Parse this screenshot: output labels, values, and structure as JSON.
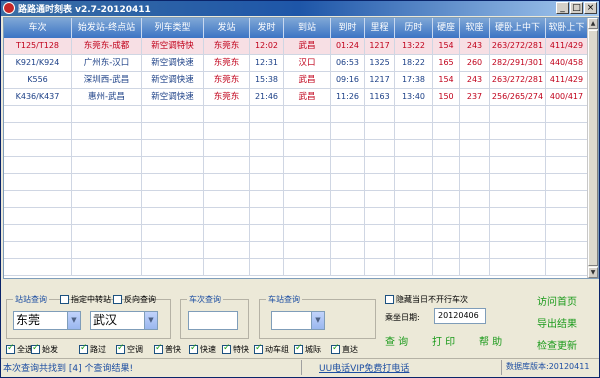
{
  "window": {
    "title": "路路通时刻表 v2.7-20120411",
    "minimize": "_",
    "maximize": "□",
    "close": "×"
  },
  "grid": {
    "columns": [
      "车次",
      "始发站-终点站",
      "列车类型",
      "发站",
      "发时",
      "到站",
      "到时",
      "里程",
      "历时",
      "硬座",
      "软座",
      "硬卧上中下",
      "软卧上下"
    ],
    "rows": [
      [
        "T125/T128",
        "东莞东-成都",
        "新空调特快",
        "东莞东",
        "12:02",
        "武昌",
        "01:24",
        "1217",
        "13:22",
        "154",
        "243",
        "263/272/281",
        "411/429"
      ],
      [
        "K921/K924",
        "广州东-汉口",
        "新空调快速",
        "东莞东",
        "12:31",
        "汉口",
        "06:53",
        "1325",
        "18:22",
        "165",
        "260",
        "282/291/301",
        "440/458"
      ],
      [
        "K556",
        "深圳西-武昌",
        "新空调快速",
        "东莞东",
        "15:38",
        "武昌",
        "09:16",
        "1217",
        "17:38",
        "154",
        "243",
        "263/272/281",
        "411/429"
      ],
      [
        "K436/K437",
        "惠州-武昌",
        "新空调快速",
        "东莞东",
        "21:46",
        "武昌",
        "11:26",
        "1163",
        "13:40",
        "150",
        "237",
        "256/265/274",
        "400/417"
      ]
    ],
    "selected_row": 0
  },
  "station_query": {
    "label": "站站查询",
    "transfer_label": "指定中转站",
    "reverse_label": "反向查询",
    "from_value": "东莞",
    "to_value": "武汉"
  },
  "train_query": {
    "label": "车次查询",
    "value": ""
  },
  "stop_query": {
    "label": "车站查询",
    "value": ""
  },
  "hide_label": "隐藏当日不开行车次",
  "date": {
    "label": "乘坐日期:",
    "value": "20120406"
  },
  "buttons": {
    "query": "查 询",
    "print": "打 印",
    "help": "帮 助",
    "home": "访问首页",
    "export": "导出结果",
    "update": "检查更新"
  },
  "filters": [
    {
      "label": "全选",
      "checked": true
    },
    {
      "label": "始发",
      "checked": true
    },
    {
      "label": "路过",
      "checked": true
    },
    {
      "label": "空调",
      "checked": true
    },
    {
      "label": "普快",
      "checked": true
    },
    {
      "label": "快速",
      "checked": true
    },
    {
      "label": "特快",
      "checked": true
    },
    {
      "label": "动车组",
      "checked": true
    },
    {
      "label": "城际",
      "checked": true
    },
    {
      "label": "直达",
      "checked": true
    }
  ],
  "status": {
    "left": "本次查询共找到 [4] 个查询结果!",
    "middle": "UU电话VIP免费打电话",
    "right": "数据库版本:20120411"
  },
  "colors": {
    "header_blue": "#3c74c4",
    "selected_row": "#f7dfe4",
    "red_text": "#c0001a",
    "blue_text": "#1b3f86",
    "green_action": "#1a9a1a"
  }
}
